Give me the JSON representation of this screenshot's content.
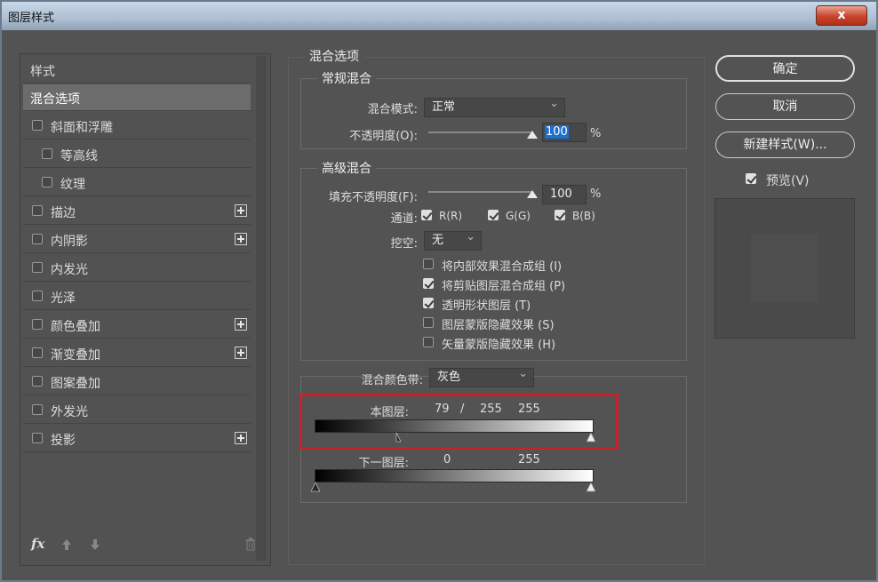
{
  "window": {
    "title": "图层样式",
    "close_label": "x"
  },
  "sidebar": {
    "header": "样式",
    "items": [
      {
        "label": "混合选项",
        "checkbox": false,
        "selected": true,
        "plus": false,
        "indent": false
      },
      {
        "label": "斜面和浮雕",
        "checkbox": true,
        "selected": false,
        "plus": false,
        "indent": false
      },
      {
        "label": "等高线",
        "checkbox": true,
        "selected": false,
        "plus": false,
        "indent": true
      },
      {
        "label": "纹理",
        "checkbox": true,
        "selected": false,
        "plus": false,
        "indent": true
      },
      {
        "label": "描边",
        "checkbox": true,
        "selected": false,
        "plus": true,
        "indent": false
      },
      {
        "label": "内阴影",
        "checkbox": true,
        "selected": false,
        "plus": true,
        "indent": false
      },
      {
        "label": "内发光",
        "checkbox": true,
        "selected": false,
        "plus": false,
        "indent": false
      },
      {
        "label": "光泽",
        "checkbox": true,
        "selected": false,
        "plus": false,
        "indent": false
      },
      {
        "label": "颜色叠加",
        "checkbox": true,
        "selected": false,
        "plus": true,
        "indent": false
      },
      {
        "label": "渐变叠加",
        "checkbox": true,
        "selected": false,
        "plus": true,
        "indent": false
      },
      {
        "label": "图案叠加",
        "checkbox": true,
        "selected": false,
        "plus": false,
        "indent": false
      },
      {
        "label": "外发光",
        "checkbox": true,
        "selected": false,
        "plus": false,
        "indent": false
      },
      {
        "label": "投影",
        "checkbox": true,
        "selected": false,
        "plus": true,
        "indent": false
      }
    ],
    "footer": {
      "fx_label": "fx",
      "up_icon": "arrow-up-icon",
      "down_icon": "arrow-down-icon",
      "trash_icon": "trash-icon"
    }
  },
  "blend": {
    "section_title": "混合选项",
    "general": {
      "title": "常规混合",
      "mode_label": "混合模式:",
      "mode_value": "正常",
      "opacity_label": "不透明度(O):",
      "opacity_value": "100",
      "opacity_unit": "%"
    },
    "advanced": {
      "title": "高级混合",
      "fill_label": "填充不透明度(F):",
      "fill_value": "100",
      "fill_unit": "%",
      "channels_label": "通道:",
      "channel_r": "R(R)",
      "channel_g": "G(G)",
      "channel_b": "B(B)",
      "knockout_label": "挖空:",
      "knockout_value": "无",
      "options": [
        {
          "label": "将内部效果混合成组 (I)",
          "checked": false
        },
        {
          "label": "将剪贴图层混合成组 (P)",
          "checked": true
        },
        {
          "label": "透明形状图层 (T)",
          "checked": true
        },
        {
          "label": "图层蒙版隐藏效果 (S)",
          "checked": false
        },
        {
          "label": "矢量蒙版隐藏效果 (H)",
          "checked": false
        }
      ]
    },
    "blend_if": {
      "label": "混合颜色带:",
      "value": "灰色",
      "this_layer": {
        "label": "本图层:",
        "v1": "79",
        "sep": "/",
        "v2": "255",
        "v3": "255"
      },
      "underlying": {
        "label": "下一图层:",
        "v1": "0",
        "v2": "255"
      }
    }
  },
  "buttons": {
    "ok": "确定",
    "cancel": "取消",
    "new_style": "新建样式(W)...",
    "preview_label": "预览(V)",
    "preview_checked": true
  },
  "colors": {
    "dialog_bg": "#535353",
    "highlight_box": "#c8222a",
    "selected_field": "#1c6fcb"
  }
}
